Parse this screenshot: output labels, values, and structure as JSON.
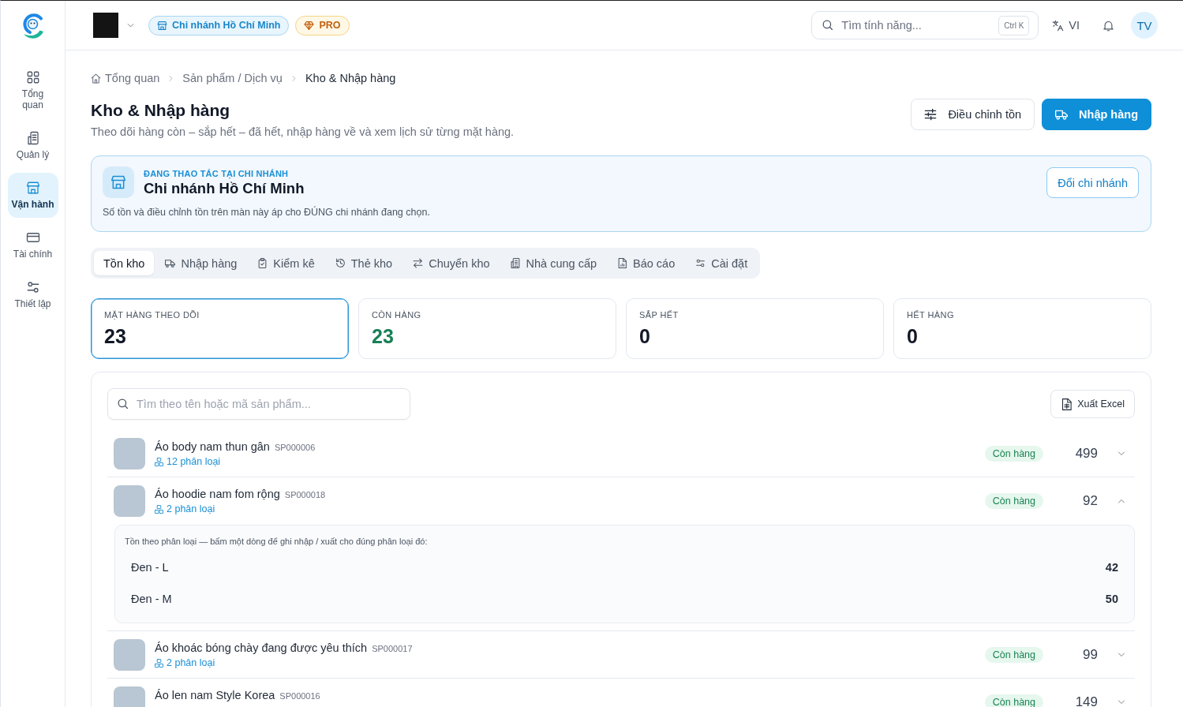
{
  "sidebar": {
    "items": [
      {
        "label": "Tổng quan",
        "selected": false
      },
      {
        "label": "Quản lý",
        "selected": false
      },
      {
        "label": "Vận hành",
        "selected": true
      },
      {
        "label": "Tài chính",
        "selected": false
      },
      {
        "label": "Thiết lập",
        "selected": false
      }
    ]
  },
  "header": {
    "branch": "Chi nhánh Hồ Chí Minh",
    "plan": "PRO",
    "search": {
      "placeholder": "Tìm tính năng...",
      "shortcut": "Ctrl K"
    },
    "language": "VI",
    "avatar": "TV"
  },
  "breadcrumb": [
    "Tổng quan",
    "Sản phẩm / Dịch vụ",
    "Kho & Nhập hàng"
  ],
  "page": {
    "title": "Kho & Nhập hàng",
    "subtitle": "Theo dõi hàng còn – sắp hết – đã hết, nhập hàng về và xem lịch sử từng mặt hàng.",
    "actions": [
      {
        "label": "Điều chỉnh tồn",
        "kind": "secondary"
      },
      {
        "label": "Nhập hàng",
        "kind": "primary"
      }
    ]
  },
  "branch_banner": {
    "eyebrow": "ĐANG THAO TÁC TẠI CHI NHÁNH",
    "name": "Chi nhánh Hồ Chí Minh",
    "note": "Số tồn và điều chỉnh tồn trên màn này áp cho ĐÚNG chi nhánh đang chọn.",
    "button": "Đổi chi nhánh"
  },
  "tabs": [
    {
      "label": "Tồn kho",
      "selected": true
    },
    {
      "label": "Nhập hàng",
      "selected": false
    },
    {
      "label": "Kiểm kê",
      "selected": false
    },
    {
      "label": "Thẻ kho",
      "selected": false
    },
    {
      "label": "Chuyển kho",
      "selected": false
    },
    {
      "label": "Nhà cung cấp",
      "selected": false
    },
    {
      "label": "Báo cáo",
      "selected": false
    },
    {
      "label": "Cài đặt",
      "selected": false
    }
  ],
  "stats": [
    {
      "label": "MẶT HÀNG THEO DÕI",
      "value": "23",
      "kind": "neutral",
      "selected": true
    },
    {
      "label": "CÒN HÀNG",
      "value": "23",
      "kind": "positive",
      "selected": false
    },
    {
      "label": "SẮP HẾT",
      "value": "0",
      "kind": "neutral",
      "selected": false
    },
    {
      "label": "HẾT HÀNG",
      "value": "0",
      "kind": "neutral",
      "selected": false
    }
  ],
  "inventory": {
    "search": {
      "placeholder": "Tìm theo tên hoặc mã sản phẩm..."
    },
    "export_button": "Xuất Excel",
    "rows": [
      {
        "name": "Áo body nam thun gân",
        "sku": "SP000006",
        "variants": "12 phân loại",
        "status": "Còn hàng",
        "quantity": "499",
        "expanded": false
      },
      {
        "name": "Áo hoodie nam fom rộng",
        "sku": "SP000018",
        "variants": "2 phân loại",
        "status": "Còn hàng",
        "quantity": "92",
        "expanded": true,
        "detail": {
          "note": "Tồn theo phân loại — bấm một dòng để ghi nhập / xuất cho đúng phân loại đó:",
          "variants": [
            {
              "name": "Đen - L",
              "quantity": "42"
            },
            {
              "name": "Đen - M",
              "quantity": "50"
            }
          ]
        }
      },
      {
        "name": "Áo khoác bóng chày đang được yêu thích",
        "sku": "SP000017",
        "variants": "2 phân loại",
        "status": "Còn hàng",
        "quantity": "99",
        "expanded": false
      },
      {
        "name": "Áo len nam Style Korea",
        "sku": "SP000016",
        "status": "Còn hàng",
        "quantity": "149",
        "expanded": false
      }
    ]
  }
}
